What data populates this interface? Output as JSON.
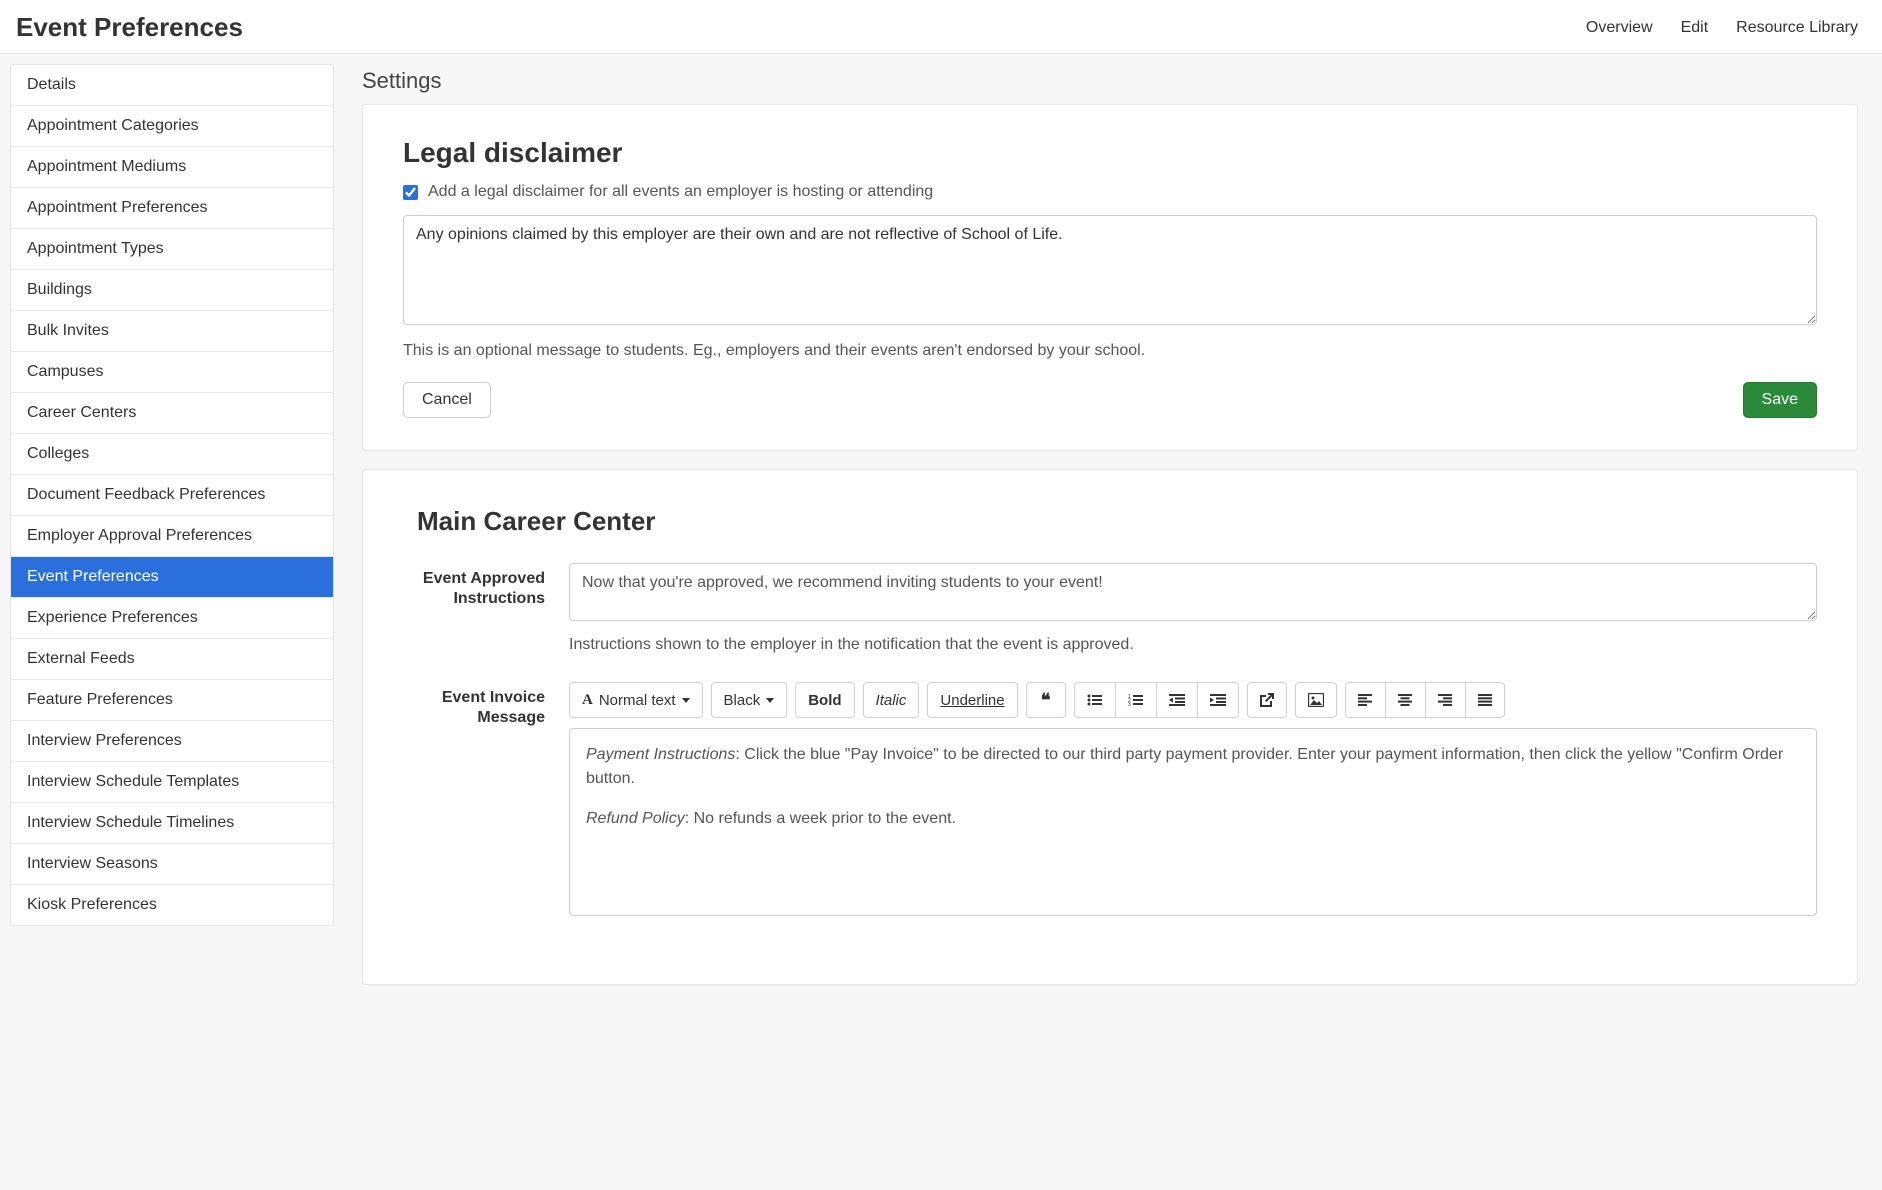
{
  "header": {
    "title": "Event Preferences",
    "nav": {
      "overview": "Overview",
      "edit": "Edit",
      "resource_library": "Resource Library"
    }
  },
  "sidebar": {
    "items": [
      "Details",
      "Appointment Categories",
      "Appointment Mediums",
      "Appointment Preferences",
      "Appointment Types",
      "Buildings",
      "Bulk Invites",
      "Campuses",
      "Career Centers",
      "Colleges",
      "Document Feedback Preferences",
      "Employer Approval Preferences",
      "Event Preferences",
      "Experience Preferences",
      "External Feeds",
      "Feature Preferences",
      "Interview Preferences",
      "Interview Schedule Templates",
      "Interview Schedule Timelines",
      "Interview Seasons",
      "Kiosk Preferences"
    ],
    "active_index": 12
  },
  "settings": {
    "heading": "Settings",
    "legal": {
      "heading": "Legal disclaimer",
      "checkbox_label": "Add a legal disclaimer for all events an employer is hosting or attending",
      "checkbox_checked": true,
      "textarea_value": "Any opinions claimed by this employer are their own and are not reflective of School of Life.",
      "help_text": "This is an optional message to students. Eg., employers and their events aren't endorsed by your school.",
      "cancel_label": "Cancel",
      "save_label": "Save"
    },
    "career_center": {
      "heading": "Main Career Center",
      "approved_label": "Event Approved Instructions",
      "approved_value": "Now that you're approved, we recommend inviting students to your event!",
      "approved_help": "Instructions shown to the employer in the notification that the event is approved.",
      "invoice_label": "Event Invoice Message",
      "toolbar": {
        "normal_text": "Normal text",
        "color": "Black",
        "bold": "Bold",
        "italic": "Italic",
        "underline": "Underline"
      },
      "editor": {
        "p1_em": "Payment Instructions",
        "p1_rest": ": Click the blue \"Pay Invoice\" to be directed to our third party payment provider. Enter your payment information, then click the yellow \"Confirm Order button.",
        "p2_em": "Refund Policy",
        "p2_rest": ": No refunds a week prior to the event."
      }
    }
  }
}
